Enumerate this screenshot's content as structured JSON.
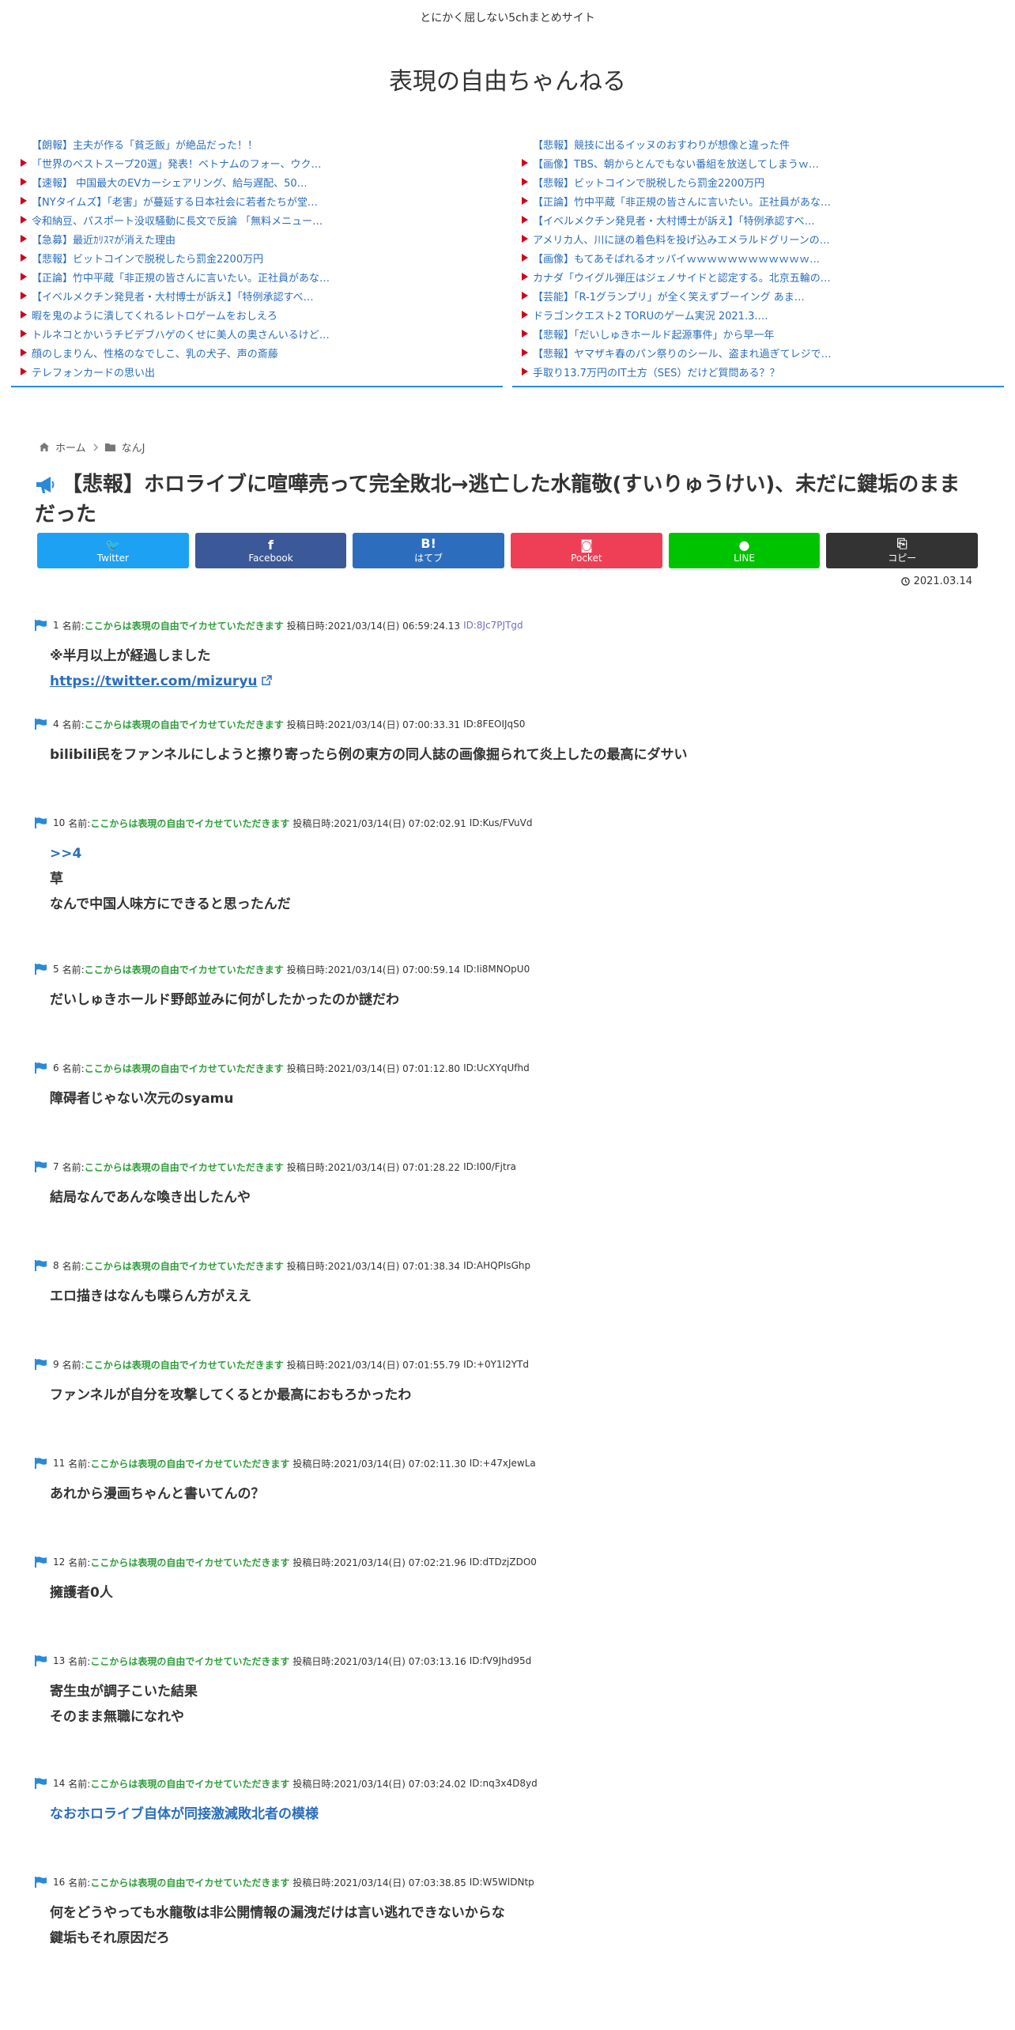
{
  "site": {
    "tagline": "とにかく屈しない5chまとめサイト",
    "title": "表現の自由ちゃんねる"
  },
  "rss": {
    "left": [
      {
        "text": "【朗報】主夫が作る「貧乏飯」が絶品だった！！",
        "marker": false
      },
      {
        "text": "「世界のベストスープ20選」発表！ベトナムのフォー、ウク…",
        "marker": true
      },
      {
        "text": "【速報】 中国最大のEVカーシェアリング、給与遅配、50…",
        "marker": true
      },
      {
        "text": "【NYタイムズ】「老害」が蔓延する日本社会に若者たちが堂…",
        "marker": true
      },
      {
        "text": "令和納豆、パスポート没収騒動に長文で反論 「無料メニュー…",
        "marker": true
      },
      {
        "text": "【急募】最近ｶﾘｽﾏが消えた理由",
        "marker": true
      },
      {
        "text": "【悲報】ビットコインで脱税したら罰金2200万円",
        "marker": true
      },
      {
        "text": "【正論】竹中平蔵「非正規の皆さんに言いたい。正社員があな…",
        "marker": true
      },
      {
        "text": "【イベルメクチン発見者・大村博士が訴え】「特例承認すべ…",
        "marker": true
      },
      {
        "text": "暇を鬼のように潰してくれるレトロゲームをおしえろ",
        "marker": true
      },
      {
        "text": "トルネコとかいうチビデブハゲのくせに美人の奥さんいるけど…",
        "marker": true
      },
      {
        "text": "顔のしまりん、性格のなでしこ、乳の犬子、声の斎藤",
        "marker": true
      },
      {
        "text": "テレフォンカードの思い出",
        "marker": true
      }
    ],
    "right": [
      {
        "text": "【悲報】競技に出るイッヌのおすわりが想像と違った件",
        "marker": false
      },
      {
        "text": "【画像】TBS、朝からとんでもない番組を放送してしまうｗ…",
        "marker": true
      },
      {
        "text": "【悲報】ビットコインで脱税したら罰金2200万円",
        "marker": true
      },
      {
        "text": "【正論】竹中平蔵「非正規の皆さんに言いたい。正社員があな…",
        "marker": true
      },
      {
        "text": "【イベルメクチン発見者・大村博士が訴え】「特例承認すべ…",
        "marker": true
      },
      {
        "text": "アメリカ人、川に謎の着色料を投げ込みエメラルドグリーンの…",
        "marker": true
      },
      {
        "text": "【画像】もてあそばれるオッパイｗｗｗｗｗｗｗｗｗｗｗｗ…",
        "marker": true
      },
      {
        "text": "カナダ「ウイグル弾圧はジェノサイドと認定する。北京五輪の…",
        "marker": true
      },
      {
        "text": "【芸能】「R-1グランプリ」が全く笑えずブーイング あま…",
        "marker": true
      },
      {
        "text": "ドラゴンクエスト2 TORUのゲーム実況 2021.3.…",
        "marker": true
      },
      {
        "text": "【悲報】「だいしゅきホールド起源事件」から早一年",
        "marker": true
      },
      {
        "text": "【悲報】ヤマザキ春のパン祭りのシール、盗まれ過ぎてレジで…",
        "marker": true
      },
      {
        "text": "手取り13.7万円のIT土方（SES）だけど質問ある？？",
        "marker": true
      }
    ]
  },
  "breadcrumb": {
    "home": "ホーム",
    "category": "なんJ"
  },
  "article": {
    "title": "【悲報】ホロライブに喧嘩売って完全敗北→逃亡した水龍敬(すいりゅうけい)、未だに鍵垢のままだった",
    "date": "2021.03.14"
  },
  "share": [
    {
      "icon": "twitter-icon",
      "glyph": "🐦",
      "label": "Twitter",
      "color": "#1da1f2"
    },
    {
      "icon": "facebook-icon",
      "glyph": "f",
      "label": "Facebook",
      "color": "#3b5998"
    },
    {
      "icon": "hatebu-icon",
      "glyph": "B!",
      "label": "はてブ",
      "color": "#2c6ebd"
    },
    {
      "icon": "pocket-icon",
      "glyph": "◙",
      "label": "Pocket",
      "color": "#ef3f56"
    },
    {
      "icon": "line-icon",
      "glyph": "●",
      "label": "LINE",
      "color": "#00c300"
    },
    {
      "icon": "copy-icon",
      "glyph": "⎘",
      "label": "コピー",
      "color": "#333333"
    }
  ],
  "comments": [
    {
      "num": "1",
      "name_label": "名前:",
      "name": "ここからは表現の自由でイカせていただきます",
      "date_label": "投稿日時:2021/03/14(日) 06:59:24.13",
      "id": "ID:8Jc7PJTgd",
      "id_color": "#6f6fc8",
      "lines": [
        "※半月以上が経過しました"
      ],
      "link": "https://twitter.com/mizuryu"
    },
    {
      "num": "4",
      "name_label": "名前:",
      "name": "ここからは表現の自由でイカせていただきます",
      "date_label": "投稿日時:2021/03/14(日) 07:00:33.31",
      "id": "ID:8FEOIJqS0",
      "lines": [
        "bilibili民をファンネルにしようと擦り寄ったら例の東方の同人誌の画像掘られて炎上したの最高にダサい"
      ]
    },
    {
      "num": "10",
      "name_label": "名前:",
      "name": "ここからは表現の自由でイカせていただきます",
      "date_label": "投稿日時:2021/03/14(日) 07:02:02.91",
      "id": "ID:Kus/FVuVd",
      "lines": [
        ">>4",
        "草",
        "なんで中国人味方にできると思ったんだ"
      ]
    },
    {
      "num": "5",
      "name_label": "名前:",
      "name": "ここからは表現の自由でイカせていただきます",
      "date_label": "投稿日時:2021/03/14(日) 07:00:59.14",
      "id": "ID:Ii8MNOpU0",
      "lines": [
        "だいしゅきホールド野郎並みに何がしたかったのか謎だわ"
      ]
    },
    {
      "num": "6",
      "name_label": "名前:",
      "name": "ここからは表現の自由でイカせていただきます",
      "date_label": "投稿日時:2021/03/14(日) 07:01:12.80",
      "id": "ID:UcXYqUfhd",
      "lines": [
        "障碍者じゃない次元のsyamu"
      ]
    },
    {
      "num": "7",
      "name_label": "名前:",
      "name": "ここからは表現の自由でイカせていただきます",
      "date_label": "投稿日時:2021/03/14(日) 07:01:28.22",
      "id": "ID:I00/Fjtra",
      "lines": [
        "結局なんであんな喚き出したんや"
      ]
    },
    {
      "num": "8",
      "name_label": "名前:",
      "name": "ここからは表現の自由でイカせていただきます",
      "date_label": "投稿日時:2021/03/14(日) 07:01:38.34",
      "id": "ID:AHQPIsGhp",
      "lines": [
        "エロ描きはなんも喋らん方がええ"
      ]
    },
    {
      "num": "9",
      "name_label": "名前:",
      "name": "ここからは表現の自由でイカせていただきます",
      "date_label": "投稿日時:2021/03/14(日) 07:01:55.79",
      "id": "ID:+0Y1I2YTd",
      "lines": [
        "ファンネルが自分を攻撃してくるとか最高におもろかったわ"
      ]
    },
    {
      "num": "11",
      "name_label": "名前:",
      "name": "ここからは表現の自由でイカせていただきます",
      "date_label": "投稿日時:2021/03/14(日) 07:02:11.30",
      "id": "ID:+47xJewLa",
      "lines": [
        "あれから漫画ちゃんと書いてんの？"
      ]
    },
    {
      "num": "12",
      "name_label": "名前:",
      "name": "ここからは表現の自由でイカせていただきます",
      "date_label": "投稿日時:2021/03/14(日) 07:02:21.96",
      "id": "ID:dTDzjZDO0",
      "lines": [
        "擁護者0人"
      ]
    },
    {
      "num": "13",
      "name_label": "名前:",
      "name": "ここからは表現の自由でイカせていただきます",
      "date_label": "投稿日時:2021/03/14(日) 07:03:13.16",
      "id": "ID:fV9Jhd95d",
      "lines": [
        "寄生虫が調子こいた結果",
        "そのまま無職になれや"
      ]
    },
    {
      "num": "14",
      "name_label": "名前:",
      "name": "ここからは表現の自由でイカせていただきます",
      "date_label": "投稿日時:2021/03/14(日) 07:03:24.02",
      "id": "ID:nq3x4D8yd",
      "lines": [
        "なおホロライブ自体が同接激減敗北者の模様"
      ],
      "blue": true
    },
    {
      "num": "16",
      "name_label": "名前:",
      "name": "ここからは表現の自由でイカせていただきます",
      "date_label": "投稿日時:2021/03/14(日) 07:03:38.85",
      "id": "ID:W5WlDNtp",
      "lines": [
        "何をどうやっても水龍敬は非公開情報の漏洩だけは言い逃れできないからな",
        "鍵垢もそれ原因だろ"
      ]
    }
  ]
}
